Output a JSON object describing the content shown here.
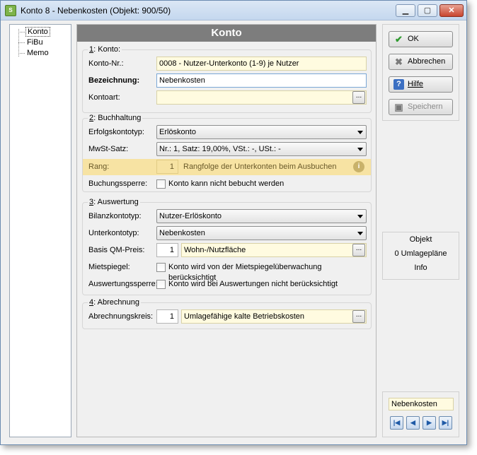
{
  "window": {
    "title": "Konto 8 - Nebenkosten  (Objekt: 900/50)",
    "app_icon_text": "S"
  },
  "tree": {
    "items": [
      "Konto",
      "FiBu",
      "Memo"
    ],
    "selected": "Konto"
  },
  "main": {
    "header": "Konto"
  },
  "konto_group": {
    "title_num": "1",
    "title_rest": ": Konto:",
    "konto_nr_label": "Konto-Nr.:",
    "konto_nr_value": "0008 - Nutzer-Unterkonto (1-9) je Nutzer",
    "bezeichnung_label": "Bezeichnung:",
    "bezeichnung_value": "Nebenkosten",
    "kontoart_label": "Kontoart:",
    "kontoart_value": "",
    "dots": "..."
  },
  "buchhaltung_group": {
    "title_num": "2",
    "title_rest": ": Buchhaltung",
    "erfolg_label": "Erfolgskontotyp:",
    "erfolg_value": "Erlöskonto",
    "mwst_label": "MwSt-Satz:",
    "mwst_value": "Nr.: 1,  Satz: 19,00%,  VSt.: -,  USt.: -",
    "rang_label": "Rang:",
    "rang_value": "1",
    "rang_desc": "Rangfolge der Unterkonten  beim Ausbuchen",
    "rang_info_icon": "i",
    "sperre_label": "Buchungssperre:",
    "sperre_text": "Konto kann nicht bebucht werden"
  },
  "auswertung_group": {
    "title_num": "3",
    "title_rest": ": Auswertung",
    "bilanz_label": "Bilanzkontotyp:",
    "bilanz_value": "Nutzer-Erlöskonto",
    "unter_label": "Unterkontotyp:",
    "unter_value": "Nebenkosten",
    "qm_label": "Basis QM-Preis:",
    "qm_num": "1",
    "qm_value": "Wohn-/Nutzfläche",
    "miet_label": "Mietspiegel:",
    "miet_text": "Konto wird von der Mietspiegelüberwachung berücksichtigt",
    "ausw_label": "Auswertungssperre:",
    "ausw_text": "Konto wird bei Auswertungen nicht berücksichtigt",
    "dots": "..."
  },
  "abrechnung_group": {
    "title_num": "4",
    "title_rest": ": Abrechnung",
    "kreis_label": "Abrechnungskreis:",
    "kreis_num": "1",
    "kreis_value": "Umlagefähige kalte Betriebskosten",
    "dots": "..."
  },
  "buttons": {
    "ok": "OK",
    "abbrechen": "Abbrechen",
    "hilfe": "Hilfe",
    "speichern": "Speichern"
  },
  "objbox": {
    "line1": "Objekt",
    "line2": "0 Umlagepläne",
    "line3": "Info"
  },
  "nav": {
    "current": "Nebenkosten",
    "first": "|◀",
    "prev": "◀",
    "next": "▶",
    "last": "▶|"
  }
}
